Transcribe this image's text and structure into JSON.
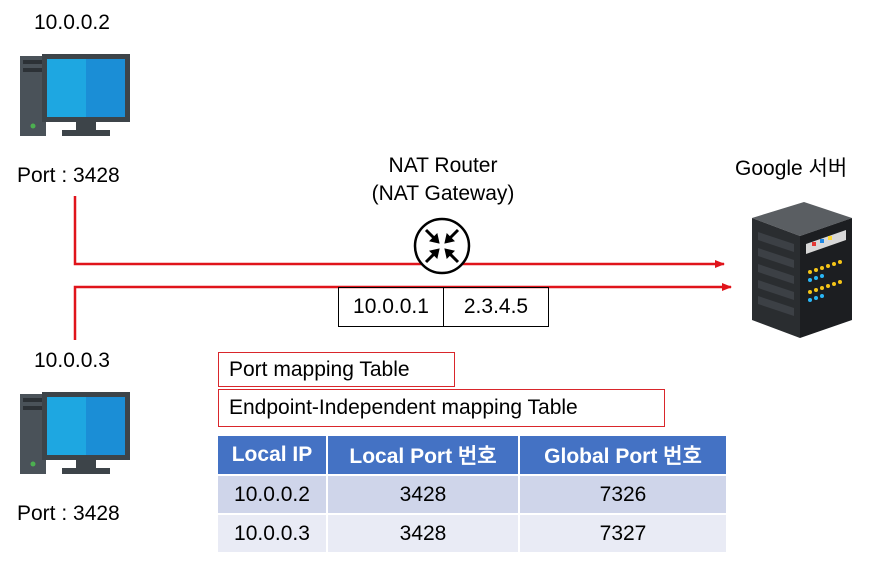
{
  "hosts": [
    {
      "ip": "10.0.0.2",
      "port_label": "Port : 3428"
    },
    {
      "ip": "10.0.0.3",
      "port_label": "Port : 3428"
    }
  ],
  "router": {
    "title": "NAT Router",
    "subtitle": "(NAT Gateway)"
  },
  "server": {
    "label": "Google 서버"
  },
  "router_ips": {
    "local": "10.0.0.1",
    "global": "2.3.4.5"
  },
  "boxes": {
    "port_mapping": "Port mapping Table",
    "endpoint_mapping": "Endpoint-Independent mapping Table"
  },
  "mapping_table": {
    "headers": [
      "Local IP",
      "Local Port 번호",
      "Global Port 번호"
    ],
    "rows": [
      [
        "10.0.0.2",
        "3428",
        "7326"
      ],
      [
        "10.0.0.3",
        "3428",
        "7327"
      ]
    ]
  },
  "colors": {
    "line": "#e0141b",
    "header": "#4472c4",
    "row1": "#cfd5ea",
    "row2": "#e9ebf5"
  }
}
